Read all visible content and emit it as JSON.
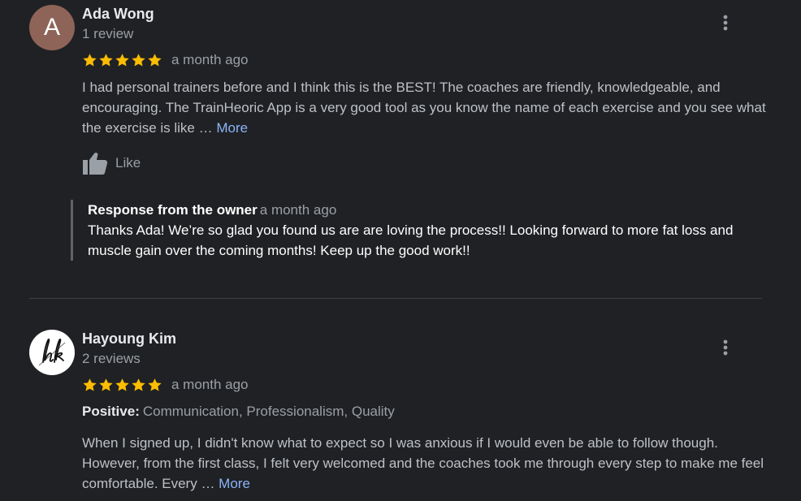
{
  "reviews": [
    {
      "avatar_letter": "A",
      "name": "Ada Wong",
      "count": "1 review",
      "rating": 5,
      "date": "a month ago",
      "text": "I had personal trainers before and I think this is the BEST!  The coaches are friendly, knowledgeable, and  encouraging. The TrainHeoric App is a very good tool as you know the name of each exercise and you see what the exercise is like … ",
      "more_label": "More",
      "like_label": "Like",
      "response": {
        "title": "Response from the owner",
        "date": "a month ago",
        "text": "Thanks Ada! We’re so glad you found us are are loving the process!! Looking forward to more fat loss and muscle gain over the coming months! Keep up the good work!!"
      }
    },
    {
      "avatar_logo": "hk",
      "name": "Hayoung Kim",
      "count": "2 reviews",
      "rating": 5,
      "date": "a month ago",
      "positive_label": "Positive:",
      "positive_values": "Communication, Professionalism, Quality",
      "text": "When I signed up, I didn't know what to expect so I was anxious if I would even be able to follow though. However, from the first class, I felt very welcomed and the coaches took me through every step to make me feel comfortable. Every … ",
      "more_label": "More"
    }
  ],
  "colors": {
    "background": "#202124",
    "star": "#fbbc04",
    "link": "#8ab4f8",
    "avatar_a": "#8e6458"
  },
  "icons": {
    "menu": "more-vert-icon",
    "like": "thumbs-up-icon",
    "star": "star-icon"
  }
}
